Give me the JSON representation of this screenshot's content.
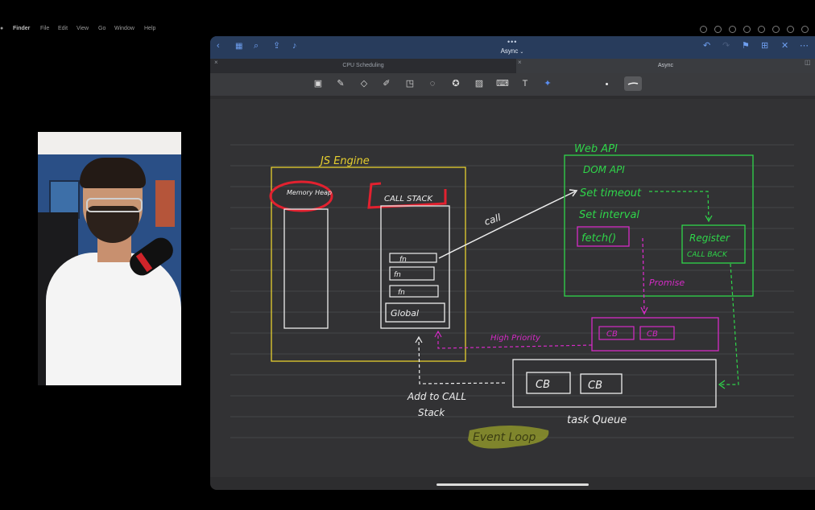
{
  "menubar": {
    "items": [
      "Finder",
      "File",
      "Edit",
      "View",
      "Go",
      "Window",
      "Help"
    ]
  },
  "document": {
    "title": "Async",
    "tabs": [
      {
        "label": "CPU Scheduling",
        "active": false
      },
      {
        "label": "Async",
        "active": true
      }
    ]
  },
  "toolbar": {
    "tools": [
      "image-tool",
      "pen-tool",
      "eraser-tool",
      "highlighter-tool",
      "shapes-tool",
      "lasso-tool",
      "sticker-tool",
      "photo-tool",
      "camera-tool",
      "text-tool",
      "laser-tool"
    ]
  },
  "diagram": {
    "js_engine_label": "JS Engine",
    "memory_heap_label": "Memory Heap",
    "call_stack_label": "CALL STACK",
    "stack_frames": [
      "fn",
      "fn",
      "fn"
    ],
    "global_frame": "Global",
    "call_arrow_label": "call",
    "web_api_label": "Web API",
    "web_api_items": [
      "DOM API",
      "Set timeout",
      "Set interval"
    ],
    "fetch_label": "fetch()",
    "register_label_1": "Register",
    "register_label_2": "CALL BACK",
    "promise_label": "Promise",
    "microtask_items": [
      "CB",
      "CB"
    ],
    "high_priority_label": "High Priority",
    "task_queue_items": [
      "CB",
      "CB"
    ],
    "task_queue_label": "task Queue",
    "add_to_stack_label_1": "Add to CALL",
    "add_to_stack_label_2": "Stack",
    "event_loop_label": "Event Loop"
  },
  "colors": {
    "engine": "#e6cf2f",
    "web_api": "#2fd64a",
    "microtask": "#d52bc6",
    "ink": "#eeeeee",
    "highlight_red": "#e2212f",
    "highlight_yellow": "#9aa12a"
  }
}
